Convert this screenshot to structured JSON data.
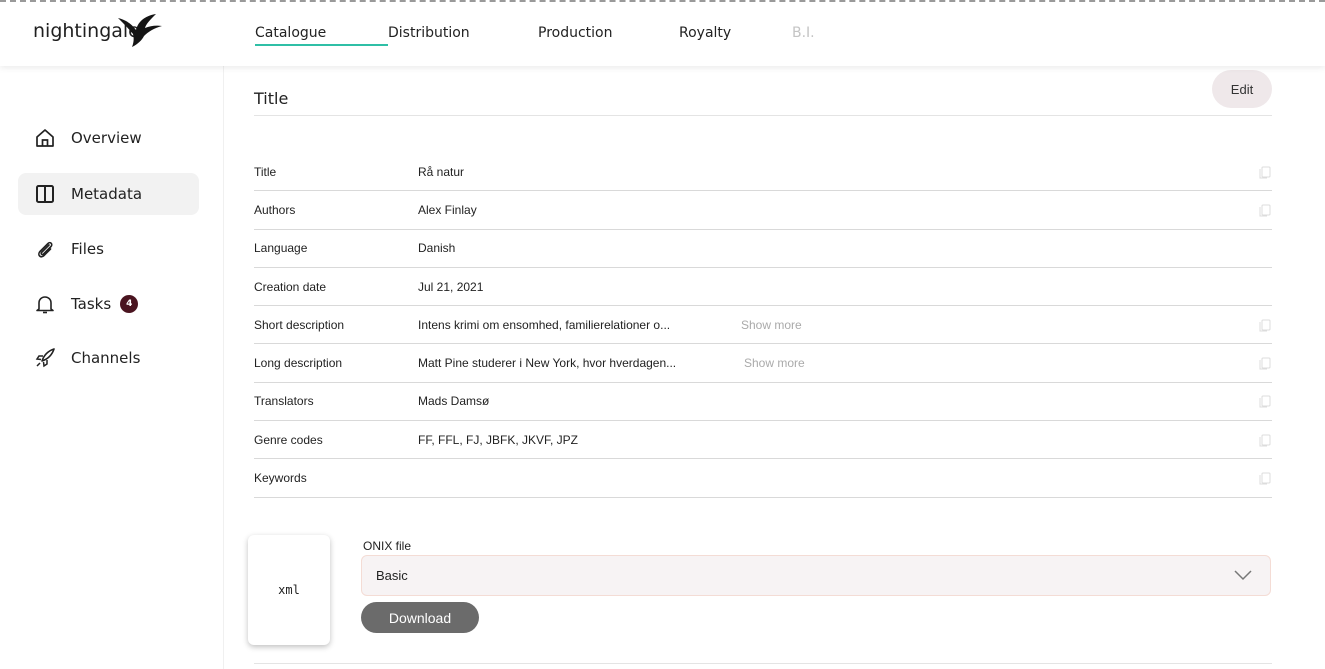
{
  "app": {
    "logo_text": "nightingale"
  },
  "top_nav": [
    {
      "label": "Catalogue",
      "active": true,
      "disabled": false
    },
    {
      "label": "Distribution",
      "active": false,
      "disabled": false
    },
    {
      "label": "Production",
      "active": false,
      "disabled": false
    },
    {
      "label": "Royalty",
      "active": false,
      "disabled": false
    },
    {
      "label": "B.I.",
      "active": false,
      "disabled": true
    }
  ],
  "sidebar": {
    "items": [
      {
        "label": "Overview",
        "icon": "home-icon",
        "active": false
      },
      {
        "label": "Metadata",
        "icon": "columns-icon",
        "active": true
      },
      {
        "label": "Files",
        "icon": "paperclip-icon",
        "active": false
      },
      {
        "label": "Tasks",
        "icon": "bell-icon",
        "active": false,
        "badge": "4"
      },
      {
        "label": "Channels",
        "icon": "rocket-icon",
        "active": false
      }
    ]
  },
  "main": {
    "section_title": "Title",
    "edit_label": "Edit",
    "rows": [
      {
        "label": "Title",
        "value": "Rå natur",
        "show_more": "",
        "copy": true
      },
      {
        "label": "Authors",
        "value": "Alex Finlay",
        "show_more": "",
        "copy": true
      },
      {
        "label": "Language",
        "value": "Danish",
        "show_more": "",
        "copy": false
      },
      {
        "label": "Creation date",
        "value": "Jul 21, 2021",
        "show_more": "",
        "copy": false
      },
      {
        "label": "Short description",
        "value": "Intens krimi om ensomhed, familierelationer o...",
        "show_more": "Show more",
        "copy": true
      },
      {
        "label": "Long description",
        "value": "Matt Pine studerer i New York, hvor hverdagen...",
        "show_more": "Show more",
        "copy": true
      },
      {
        "label": "Translators",
        "value": "Mads Damsø",
        "show_more": "",
        "copy": true
      },
      {
        "label": "Genre codes",
        "value": "FF, FFL, FJ, JBFK, JKVF, JPZ",
        "show_more": "",
        "copy": true
      },
      {
        "label": "Keywords",
        "value": "",
        "show_more": "",
        "copy": true
      }
    ],
    "onix": {
      "card_text": "xml",
      "label": "ONIX file",
      "selected": "Basic",
      "download_label": "Download"
    }
  },
  "colors": {
    "accent_underline": "#2fbfa6",
    "badge_bg": "#4a1420",
    "edit_bg": "#efe8ea",
    "download_bg": "#6b6b6b"
  }
}
